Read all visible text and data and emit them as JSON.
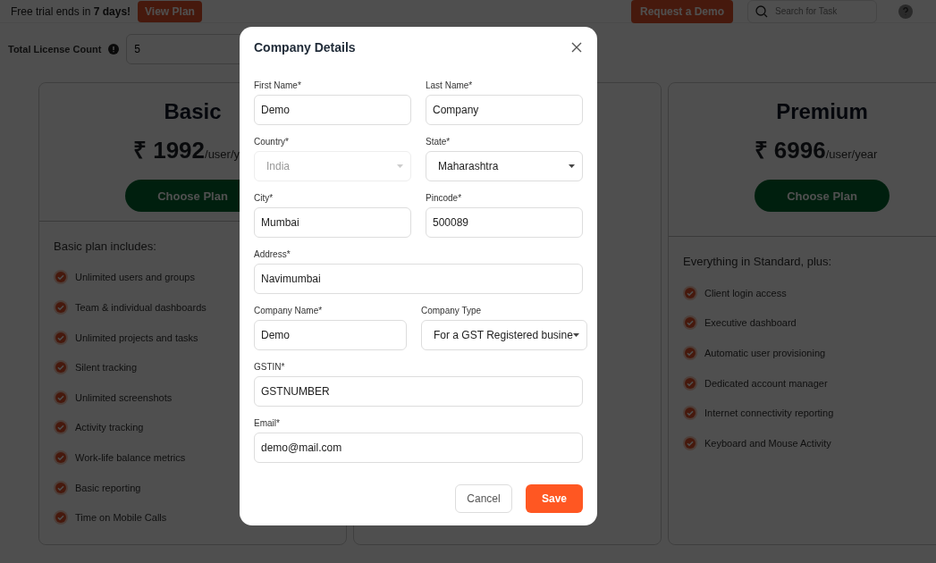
{
  "top_bar": {
    "trial_notice": "Free trial ends in **7 days!**",
    "view_plan_button": "View Plan",
    "demo_button": "Request a Demo",
    "search": {
      "placeholder": "Search for Task"
    }
  },
  "license": {
    "label": "Total License Count",
    "value": "5"
  },
  "plans": [
    {
      "name": "Basic",
      "price": "₹ 1992",
      "unit": "/user/y",
      "button": "Choose Plan",
      "heading": "Basic plan includes:",
      "features": [
        "Unlimited users and groups",
        "Team & individual dashboards",
        "Unlimited projects and tasks",
        "Silent tracking",
        "Unlimited screenshots",
        "Activity tracking",
        "Work-life balance metrics",
        "Basic reporting",
        "Time on Mobile Calls"
      ]
    },
    {
      "name": "Premium",
      "price": "₹ 6996",
      "unit": "/user/year",
      "button": "Choose Plan",
      "heading": "Everything in Standard, plus:",
      "features": [
        "Client login access",
        "Executive dashboard",
        "Automatic user provisioning",
        "Dedicated account manager",
        "Internet connectivity reporting",
        "Keyboard and Mouse Activity"
      ]
    }
  ],
  "modal": {
    "title": "Company Details",
    "rows": [
      [
        {
          "label": "First Name*",
          "value": "Demo",
          "kind": "text",
          "disabled": false
        },
        {
          "label": "Last Name*",
          "value": "Company",
          "kind": "text",
          "disabled": false
        }
      ],
      [
        {
          "label": "Country*",
          "value": "India",
          "kind": "select",
          "disabled": true
        },
        {
          "label": "State*",
          "value": "Maharashtra",
          "kind": "select",
          "disabled": false
        }
      ],
      [
        {
          "label": "City*",
          "value": "Mumbai",
          "kind": "text",
          "disabled": false
        },
        {
          "label": "Pincode*",
          "value": "500089",
          "kind": "text",
          "disabled": false
        }
      ],
      [
        {
          "label": "Address*",
          "value": "Navimumbai",
          "kind": "text",
          "disabled": false
        }
      ],
      [
        {
          "label": "Company Name*",
          "value": "Demo",
          "kind": "text",
          "disabled": false
        },
        {
          "label": "Company Type",
          "value": "For a GST Registered busine",
          "kind": "select",
          "disabled": false
        }
      ],
      [
        {
          "label": "GSTIN*",
          "value": "GSTNUMBER",
          "kind": "text",
          "disabled": false
        }
      ],
      [
        {
          "label": "Email*",
          "value": "demo@mail.com",
          "kind": "text",
          "disabled": false
        }
      ]
    ],
    "buttons": [
      {
        "label": "Cancel",
        "kind": "secondary"
      },
      {
        "label": "Save",
        "kind": "primary"
      }
    ]
  }
}
